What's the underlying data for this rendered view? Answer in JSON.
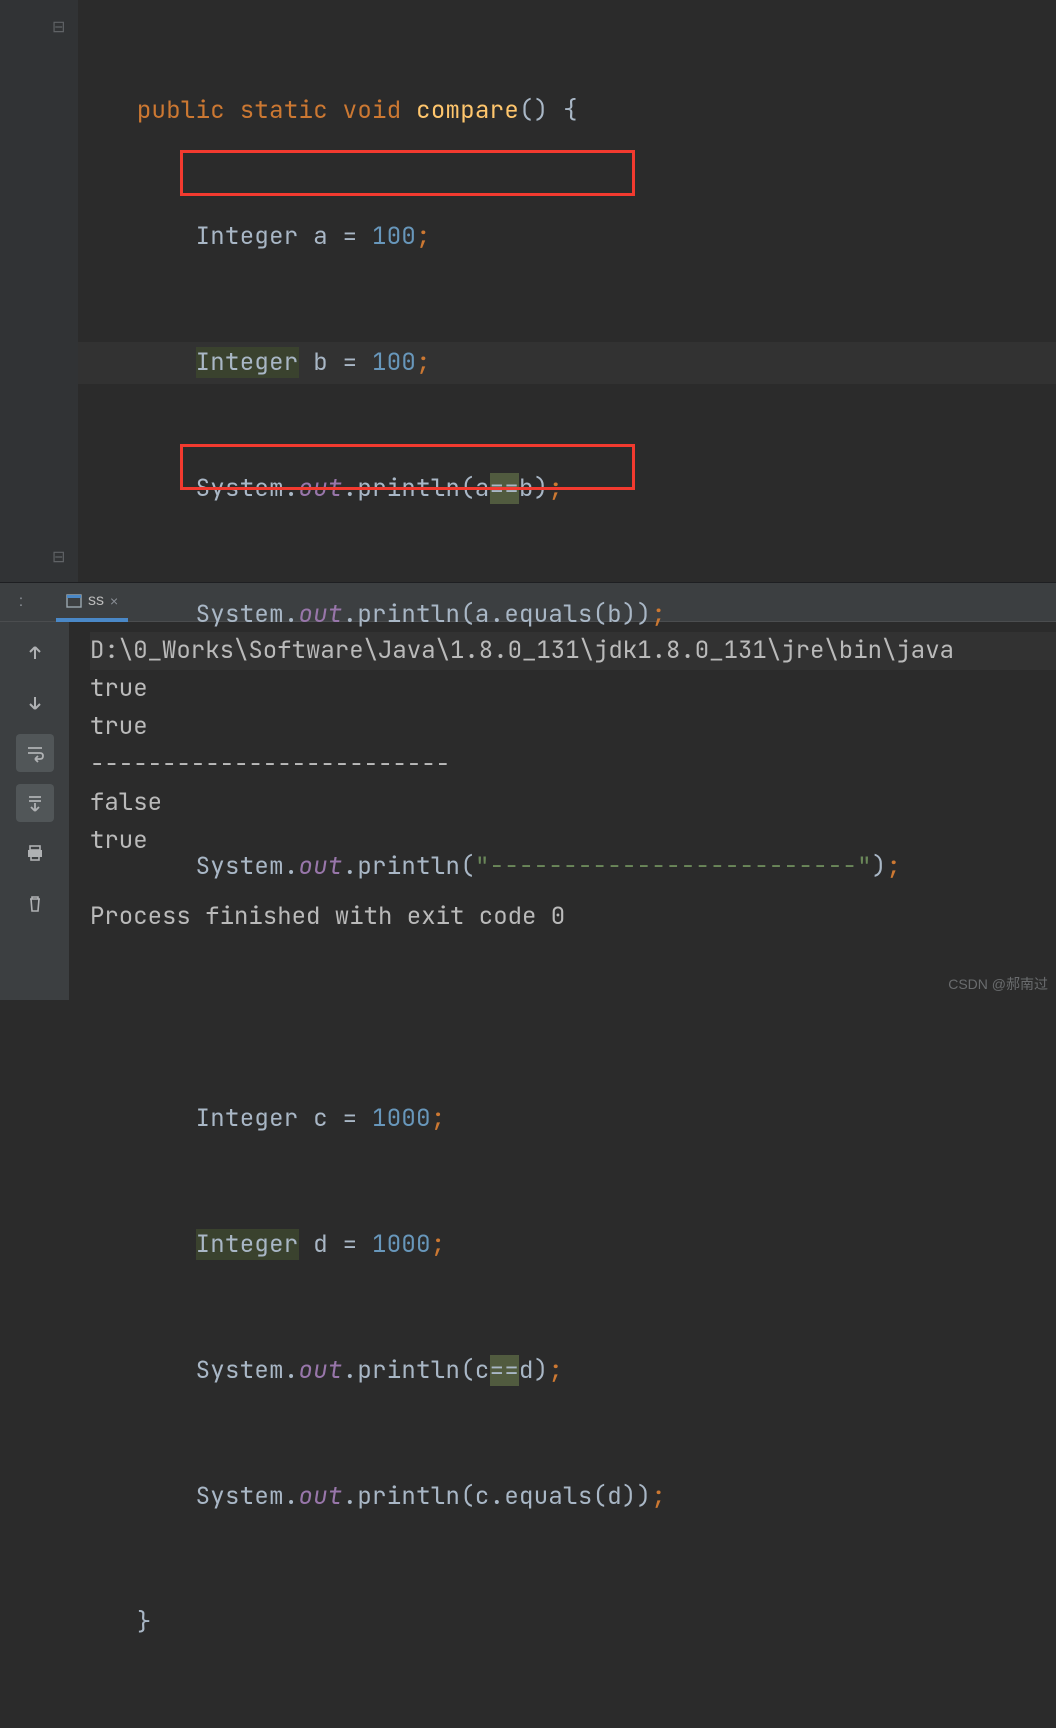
{
  "code": {
    "kw_public": "public",
    "kw_static": "static",
    "kw_void": "void",
    "fn_compare": "compare",
    "sig_tail": "() {",
    "type_integer": "Integer",
    "a": "a",
    "b": "b",
    "c": "c",
    "d": "d",
    "assign": " = ",
    "n100": "100",
    "n1000": "1000",
    "semi": ";",
    "system": "System",
    "dot": ".",
    "out": "out",
    "println": "println",
    "p_a_eq_b_open": "(a",
    "eqeq": "==",
    "p_a_eq_b_close": "b)",
    "p_a_equals_b": "(a.equals(b))",
    "dashes": "\"-------------------------\"",
    "p_c_eq_d_open": "(c",
    "p_c_eq_d_close": "d)",
    "p_c_equals_d": "(c.equals(d))",
    "close_brace": "}"
  },
  "tabs": {
    "run_label": ":",
    "tab_name": "ss",
    "close": "×"
  },
  "console": {
    "cmd": "D:\\0_Works\\Software\\Java\\1.8.0_131\\jdk1.8.0_131\\jre\\bin\\java",
    "l1": "true",
    "l2": "true",
    "l3": "-------------------------",
    "l4": "false",
    "l5": "true",
    "exit": "Process finished with exit code 0"
  },
  "watermark": "CSDN @郝南过"
}
